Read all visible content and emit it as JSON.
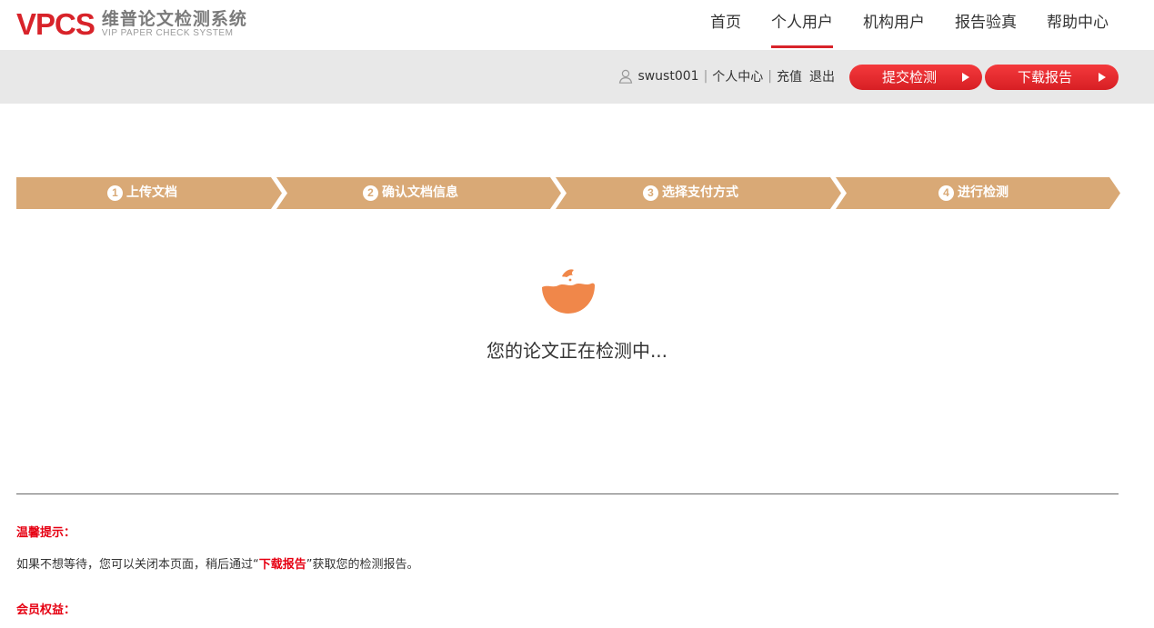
{
  "logo": {
    "mark": "VPCS",
    "cn": "维普论文检测系统",
    "en": "VIP PAPER CHECK SYSTEM"
  },
  "nav": {
    "items": [
      {
        "label": "首页",
        "active": false
      },
      {
        "label": "个人用户",
        "active": true
      },
      {
        "label": "机构用户",
        "active": false
      },
      {
        "label": "报告验真",
        "active": false
      },
      {
        "label": "帮助中心",
        "active": false
      }
    ]
  },
  "userbar": {
    "username": "swust001",
    "personal_center": "个人中心",
    "recharge": "充值",
    "logout": "退出",
    "submit_button": "提交检测",
    "download_button": "下载报告"
  },
  "steps": [
    {
      "num": "1",
      "label": "上传文档"
    },
    {
      "num": "2",
      "label": "确认文档信息"
    },
    {
      "num": "3",
      "label": "选择支付方式"
    },
    {
      "num": "4",
      "label": "进行检测"
    }
  ],
  "status_text": "您的论文正在检测中...",
  "tips": {
    "title": "温馨提示：",
    "text_before": "如果不想等待，您可以关闭本页面，稍后通过“",
    "highlight": "下载报告",
    "text_after": "”获取您的检测报告。",
    "member_title": "会员权益："
  },
  "colors": {
    "accent": "#d8232a",
    "step_bg": "#d9a976",
    "loading": "#f0874a",
    "bar_bg": "#e8e8e8"
  }
}
